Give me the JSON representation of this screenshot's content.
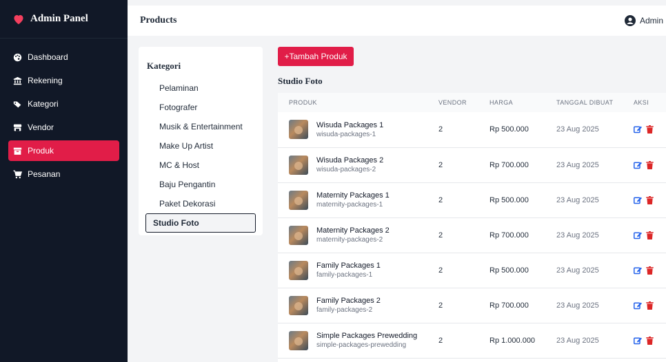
{
  "sidebar": {
    "brand": "Admin Panel",
    "items": [
      {
        "label": "Dashboard",
        "icon": "palette-icon"
      },
      {
        "label": "Rekening",
        "icon": "bank-icon"
      },
      {
        "label": "Kategori",
        "icon": "tags-icon"
      },
      {
        "label": "Vendor",
        "icon": "store-icon"
      },
      {
        "label": "Produk",
        "icon": "box-icon",
        "active": true
      },
      {
        "label": "Pesanan",
        "icon": "cart-icon"
      }
    ]
  },
  "header": {
    "title": "Products",
    "user": "Admin"
  },
  "kategori": {
    "title": "Kategori",
    "items": [
      "Pelaminan",
      "Fotografer",
      "Musik & Entertainment",
      "Make Up Artist",
      "MC & Host",
      "Baju Pengantin",
      "Paket Dekorasi",
      "Studio Foto"
    ],
    "active": "Studio Foto"
  },
  "main": {
    "add_button": "+Tambah Produk",
    "section_title": "Studio Foto",
    "columns": [
      "PRODUK",
      "VENDOR",
      "HARGA",
      "TANGGAL DIBUAT",
      "AKSI"
    ],
    "rows": [
      {
        "name": "Wisuda Packages 1",
        "slug": "wisuda-packages-1",
        "vendor": "2",
        "harga": "Rp 500.000",
        "tanggal": "23 Aug 2025"
      },
      {
        "name": "Wisuda Packages 2",
        "slug": "wisuda-packages-2",
        "vendor": "2",
        "harga": "Rp 700.000",
        "tanggal": "23 Aug 2025"
      },
      {
        "name": "Maternity Packages 1",
        "slug": "maternity-packages-1",
        "vendor": "2",
        "harga": "Rp 500.000",
        "tanggal": "23 Aug 2025"
      },
      {
        "name": "Maternity Packages 2",
        "slug": "maternity-packages-2",
        "vendor": "2",
        "harga": "Rp 700.000",
        "tanggal": "23 Aug 2025"
      },
      {
        "name": "Family Packages 1",
        "slug": "family-packages-1",
        "vendor": "2",
        "harga": "Rp 500.000",
        "tanggal": "23 Aug 2025"
      },
      {
        "name": "Family Packages 2",
        "slug": "family-packages-2",
        "vendor": "2",
        "harga": "Rp 700.000",
        "tanggal": "23 Aug 2025"
      },
      {
        "name": "Simple Packages Prewedding",
        "slug": "simple-packages-prewedding",
        "vendor": "2",
        "harga": "Rp 1.000.000",
        "tanggal": "23 Aug 2025"
      }
    ]
  },
  "colors": {
    "accent": "#e11d48",
    "sidebar": "#111827",
    "edit": "#2563eb",
    "delete": "#dc2626"
  }
}
